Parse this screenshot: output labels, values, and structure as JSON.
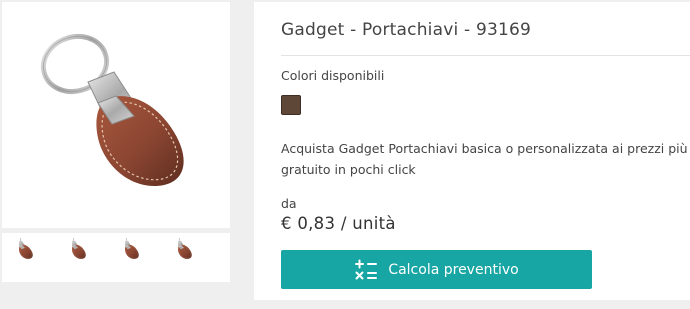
{
  "product": {
    "title": "Gadget - Portachiavi - 93169",
    "colors_label": "Colori disponibili",
    "colors": [
      {
        "name": "brown",
        "hex": "#5e4737"
      }
    ],
    "description": "Acquista Gadget Portachiavi basica o personalizzata ai prezzi più gratuito in pochi click",
    "from_label": "da",
    "price": "€ 0,83 / unità",
    "cta_label": "Calcola preventivo",
    "cta_icon": "calculator-icon",
    "image_icon": "keychain-image",
    "thumbnail_count": 4
  },
  "colors": {
    "accent": "#17a6a3",
    "leather": "#8e4a34",
    "background": "#efefef"
  }
}
